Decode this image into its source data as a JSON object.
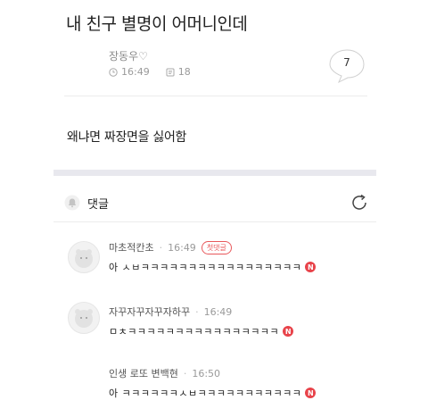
{
  "post": {
    "title": "내 친구 별명이 어머니인데",
    "author": "장동우♡",
    "time": "16:49",
    "views": "18",
    "comment_count": "7",
    "content": "왜냐면 짜장면을 싫어함"
  },
  "comments_header": {
    "label": "댓글"
  },
  "comments": [
    {
      "name": "마초적칸초",
      "time": "16:49",
      "badge": "첫댓글",
      "text": "아 ㅅㅂㅋㅋㅋㅋㅋㅋㅋㅋㅋㅋㅋㅋㅋㅋㅋㅋㅋ",
      "new": "N"
    },
    {
      "name": "자꾸자꾸자꾸자하꾸",
      "time": "16:49",
      "text": "ㅁㅊㅋㅋㅋㅋㅋㅋㅋㅋㅋㅋㅋㅋㅋㅋㅋㅋ",
      "new": "N"
    },
    {
      "name": "인생 로또 변백현",
      "time": "16:50",
      "text": "아 ㅋㅋㅋㅋㅋㅋㅅㅂㅋㅋㅋㅋㅋㅋㅋㅋㅋㅋㅋ",
      "new": "N"
    }
  ],
  "icons": [
    "clock-icon",
    "view-icon",
    "bell-icon",
    "refresh-icon",
    "speech-bubble-icon"
  ],
  "colors": {
    "accent": "#e8434a",
    "divider_band": "#e8e8ee"
  }
}
